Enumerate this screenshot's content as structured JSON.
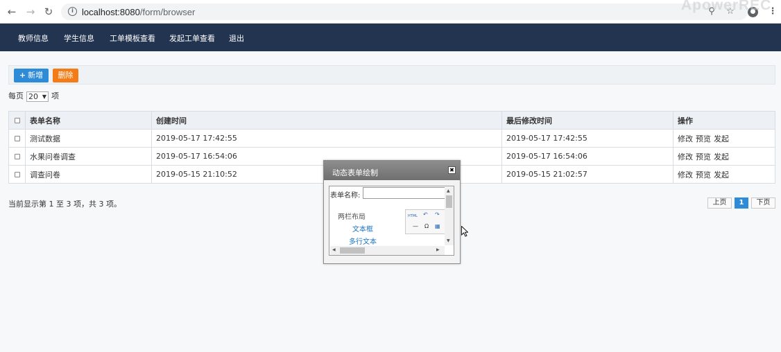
{
  "browser": {
    "url_host": "localhost:8080",
    "url_path": "/form/browser",
    "watermark": "ApowerREC"
  },
  "nav": {
    "items": [
      "教师信息",
      "学生信息",
      "工单模板查看",
      "发起工单查看",
      "退出"
    ]
  },
  "toolbar": {
    "add_label": "新增",
    "delete_label": "删除"
  },
  "page_size": {
    "prefix": "每页",
    "value": "20",
    "suffix": "项"
  },
  "table": {
    "headers": [
      "表单名称",
      "创建时间",
      "最后修改时间",
      "操作"
    ],
    "rows": [
      {
        "name": "测试数据",
        "created": "2019-05-17 17:42:55",
        "modified": "2019-05-17 17:42:55"
      },
      {
        "name": "水果问卷调查",
        "created": "2019-05-17 16:54:06",
        "modified": "2019-05-17 16:54:06"
      },
      {
        "name": "调查问卷",
        "created": "2019-05-15 21:10:52",
        "modified": "2019-05-15 21:02:57"
      }
    ],
    "actions": [
      "修改",
      "预览",
      "发起"
    ]
  },
  "footer": {
    "status": "当前显示第 1 至 3 项，共 3 项。",
    "prev": "上页",
    "current_page": "1",
    "next": "下页"
  },
  "dialog": {
    "title": "动态表单绘制",
    "form_name_label": "表单名称:",
    "group_label": "两栏布局",
    "link_textbox": "文本框",
    "link_textarea": "多行文本",
    "tool_html": "HTML"
  },
  "colors": {
    "nav_bg": "#22344f",
    "add_button": "#2e8bd8",
    "delete_button": "#f47c16"
  }
}
